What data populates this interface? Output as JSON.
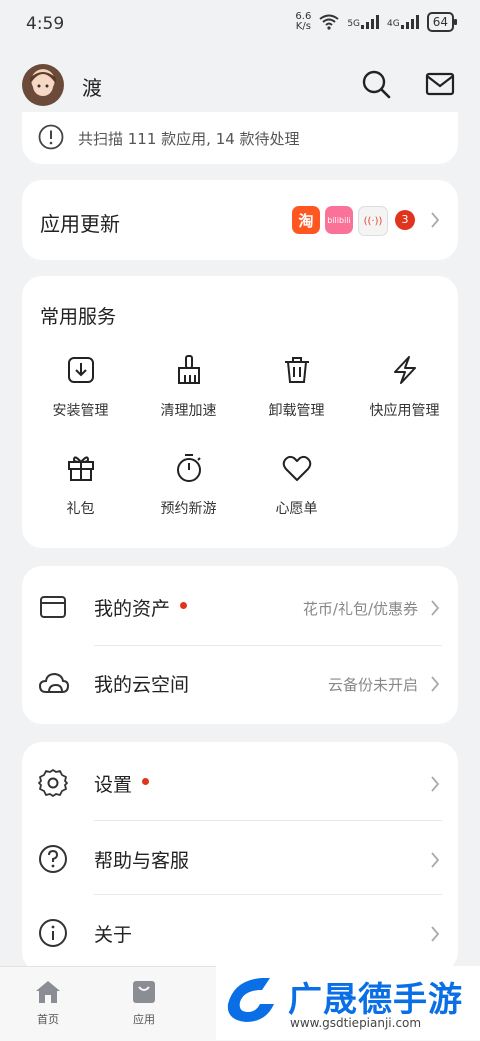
{
  "status_bar": {
    "time": "4:59",
    "speed_value": "6.6",
    "speed_unit": "K/s",
    "sig1": "5G",
    "sig2": "4G",
    "battery": "64"
  },
  "header": {
    "username": "渡"
  },
  "scan": {
    "text": "共扫描 111 款应用, 14 款待处理"
  },
  "updates": {
    "title": "应用更新",
    "apps": [
      "淘",
      "bilibili",
      "((·))"
    ],
    "count": "3"
  },
  "services": {
    "title": "常用服务",
    "items": [
      "安装管理",
      "清理加速",
      "卸载管理",
      "快应用管理",
      "礼包",
      "预约新游",
      "心愿单"
    ]
  },
  "assets": {
    "rows": [
      {
        "label": "我的资产",
        "value": "花币/礼包/优惠券"
      },
      {
        "label": "我的云空间",
        "value": "云备份未开启"
      }
    ]
  },
  "settings": {
    "rows": [
      "设置",
      "帮助与客服",
      "关于"
    ]
  },
  "nav": {
    "home": "首页",
    "apps": "应用"
  },
  "watermark": {
    "brand": "广晟德手游",
    "url": "www.gsdtiepianji.com"
  },
  "colors": {
    "accent_red": "#e0341f",
    "brand_blue": "#0a6fe6"
  }
}
